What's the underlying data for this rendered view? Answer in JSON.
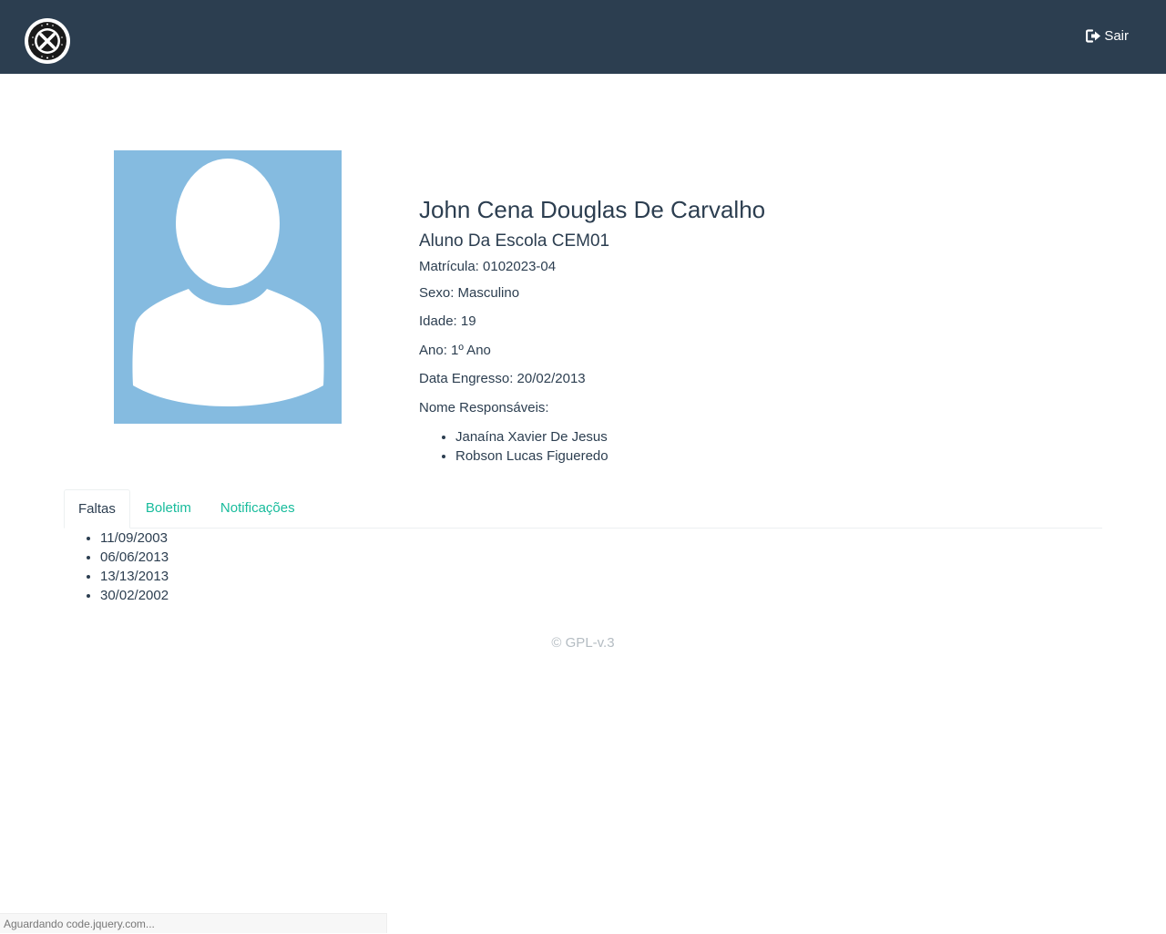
{
  "header": {
    "logout_label": "Sair",
    "logout_icon": "sign-out-icon",
    "logo_icon": "school-crest-logo"
  },
  "profile": {
    "name": "John Cena Douglas De Carvalho",
    "subtitle": "Aluno Da Escola CEM01",
    "registration": "Matrícula: 0102023-04",
    "sex": "Sexo: Masculino",
    "age": "Idade: 19",
    "year": "Ano: 1º Ano",
    "enrollment_date": "Data Engresso: 20/02/2013",
    "guardians_label": "Nome Responsáveis:",
    "guardians": [
      "Janaína Xavier De Jesus",
      "Robson Lucas Figueredo"
    ]
  },
  "tabs": [
    {
      "label": "Faltas",
      "active": true
    },
    {
      "label": "Boletim",
      "active": false
    },
    {
      "label": "Notificações",
      "active": false
    }
  ],
  "absences": [
    "11/09/2003",
    "06/06/2013",
    "13/13/2013",
    "30/02/2002"
  ],
  "footer": {
    "text": "© GPL-v.3"
  },
  "status_bar": {
    "text": "Aguardando code.jquery.com..."
  },
  "colors": {
    "navbar": "#2c3e50",
    "accent": "#18bc9c",
    "avatar_bg": "#85bbe0"
  }
}
